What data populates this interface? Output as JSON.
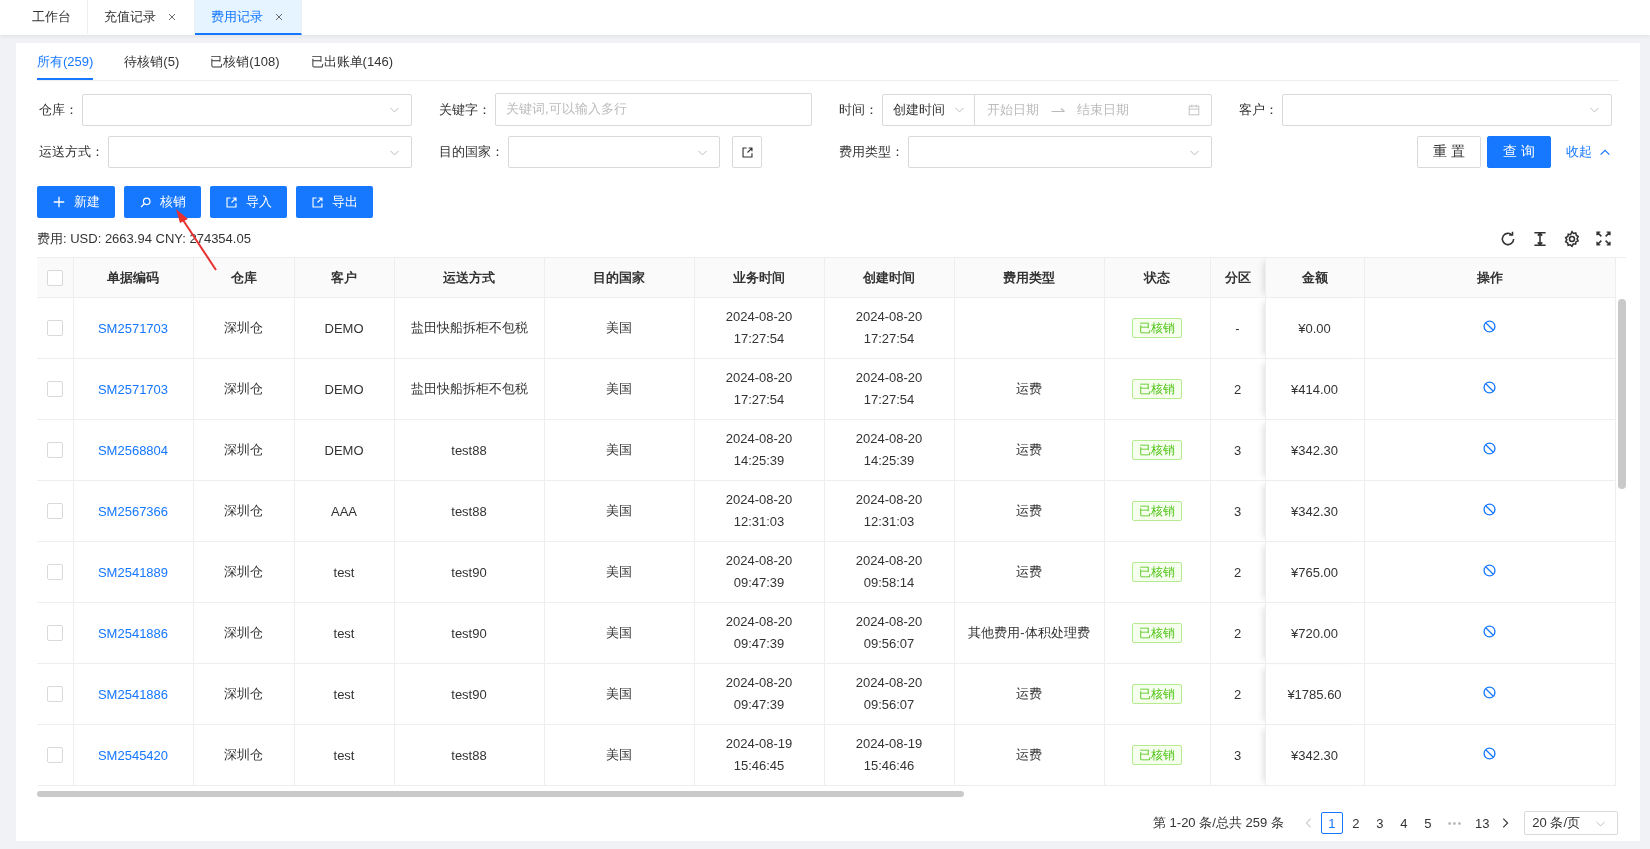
{
  "tabs": [
    {
      "label": "工作台",
      "closable": false,
      "selected": false
    },
    {
      "label": "充值记录",
      "closable": true,
      "selected": false
    },
    {
      "label": "费用记录",
      "closable": true,
      "selected": true
    }
  ],
  "status_tabs": [
    {
      "label": "所有(259)",
      "selected": true
    },
    {
      "label": "待核销(5)",
      "selected": false
    },
    {
      "label": "已核销(108)",
      "selected": false
    },
    {
      "label": "已出账单(146)",
      "selected": false
    }
  ],
  "filters": [
    {
      "label": "仓库：",
      "kind": "select"
    },
    {
      "label": "关键字：",
      "kind": "textarea",
      "placeholder": "关键词,可以输入多行"
    },
    {
      "label": "时间：",
      "kind": "daterange",
      "mode": "创建时间",
      "start_placeholder": "开始日期",
      "end_placeholder": "结束日期"
    },
    {
      "label": "客户：",
      "kind": "select"
    },
    {
      "label": "运送方式：",
      "kind": "select"
    },
    {
      "label": "目的国家：",
      "kind": "selectbutton"
    },
    {
      "label": "费用类型：",
      "kind": "select"
    }
  ],
  "form_actions": {
    "reset": "重 置",
    "query": "查 询",
    "collapse": "收起"
  },
  "toolbar": [
    {
      "label": "新建",
      "kind": "plus"
    },
    {
      "label": "核销",
      "kind": "search"
    },
    {
      "label": "导入",
      "kind": "export"
    },
    {
      "label": "导出",
      "kind": "export"
    }
  ],
  "summary": "费用: USD: 2663.94 CNY: 274354.05",
  "table": {
    "all_checked": false,
    "columns": [
      "单据编码",
      "仓库",
      "客户",
      "运送方式",
      "目的国家",
      "业务时间",
      "创建时间",
      "费用类型",
      "状态",
      "分区",
      "金额",
      "操作"
    ],
    "rows": [
      {
        "checked": false,
        "code": "SM2571703",
        "warehouse": "深圳仓",
        "customer": "DEMO",
        "shipping": "盐田快船拆柜不包税",
        "country": "美国",
        "biz_time": "2024-08-20 17:27:54",
        "created_time": "2024-08-20 17:27:54",
        "status": "已核销",
        "zone": "-",
        "amount": "¥0.00"
      },
      {
        "checked": false,
        "code": "SM2571703",
        "warehouse": "深圳仓",
        "customer": "DEMO",
        "shipping": "盐田快船拆柜不包税",
        "country": "美国",
        "biz_time": "2024-08-20 17:27:54",
        "created_time": "2024-08-20 17:27:54",
        "fee_type": "运费",
        "status": "已核销",
        "zone": "2",
        "amount": "¥414.00"
      },
      {
        "checked": false,
        "code": "SM2568804",
        "warehouse": "深圳仓",
        "customer": "DEMO",
        "shipping": "test88",
        "country": "美国",
        "biz_time": "2024-08-20 14:25:39",
        "created_time": "2024-08-20 14:25:39",
        "fee_type": "运费",
        "status": "已核销",
        "zone": "3",
        "amount": "¥342.30"
      },
      {
        "checked": false,
        "code": "SM2567366",
        "warehouse": "深圳仓",
        "customer": "AAA",
        "shipping": "test88",
        "country": "美国",
        "biz_time": "2024-08-20 12:31:03",
        "created_time": "2024-08-20 12:31:03",
        "fee_type": "运费",
        "status": "已核销",
        "zone": "3",
        "amount": "¥342.30"
      },
      {
        "checked": false,
        "code": "SM2541889",
        "warehouse": "深圳仓",
        "customer": "test",
        "shipping": "test90",
        "country": "美国",
        "biz_time": "2024-08-20 09:47:39",
        "created_time": "2024-08-20 09:58:14",
        "fee_type": "运费",
        "status": "已核销",
        "zone": "2",
        "amount": "¥765.00"
      },
      {
        "checked": false,
        "code": "SM2541886",
        "warehouse": "深圳仓",
        "customer": "test",
        "shipping": "test90",
        "country": "美国",
        "biz_time": "2024-08-20 09:47:39",
        "created_time": "2024-08-20 09:56:07",
        "fee_type": "其他费用-体积处理费",
        "status": "已核销",
        "zone": "2",
        "amount": "¥720.00"
      },
      {
        "checked": false,
        "code": "SM2541886",
        "warehouse": "深圳仓",
        "customer": "test",
        "shipping": "test90",
        "country": "美国",
        "biz_time": "2024-08-20 09:47:39",
        "created_time": "2024-08-20 09:56:07",
        "fee_type": "运费",
        "status": "已核销",
        "zone": "2",
        "amount": "¥1785.60"
      },
      {
        "checked": false,
        "code": "SM2545420",
        "warehouse": "深圳仓",
        "customer": "test",
        "shipping": "test88",
        "country": "美国",
        "biz_time": "2024-08-19 15:46:45",
        "created_time": "2024-08-19 15:46:46",
        "fee_type": "运费",
        "status": "已核销",
        "zone": "3",
        "amount": "¥342.30"
      }
    ]
  },
  "pagination": {
    "summary": "第 1-20 条/总共 259 条",
    "pages": [
      {
        "label": "1",
        "selected": true
      },
      {
        "label": "2",
        "selected": false
      },
      {
        "label": "3",
        "selected": false
      },
      {
        "label": "4",
        "selected": false
      },
      {
        "label": "5",
        "selected": false
      },
      {
        "label": "13",
        "selected": false
      }
    ],
    "ellipsis": "•••",
    "page_size": "20 条/页"
  }
}
